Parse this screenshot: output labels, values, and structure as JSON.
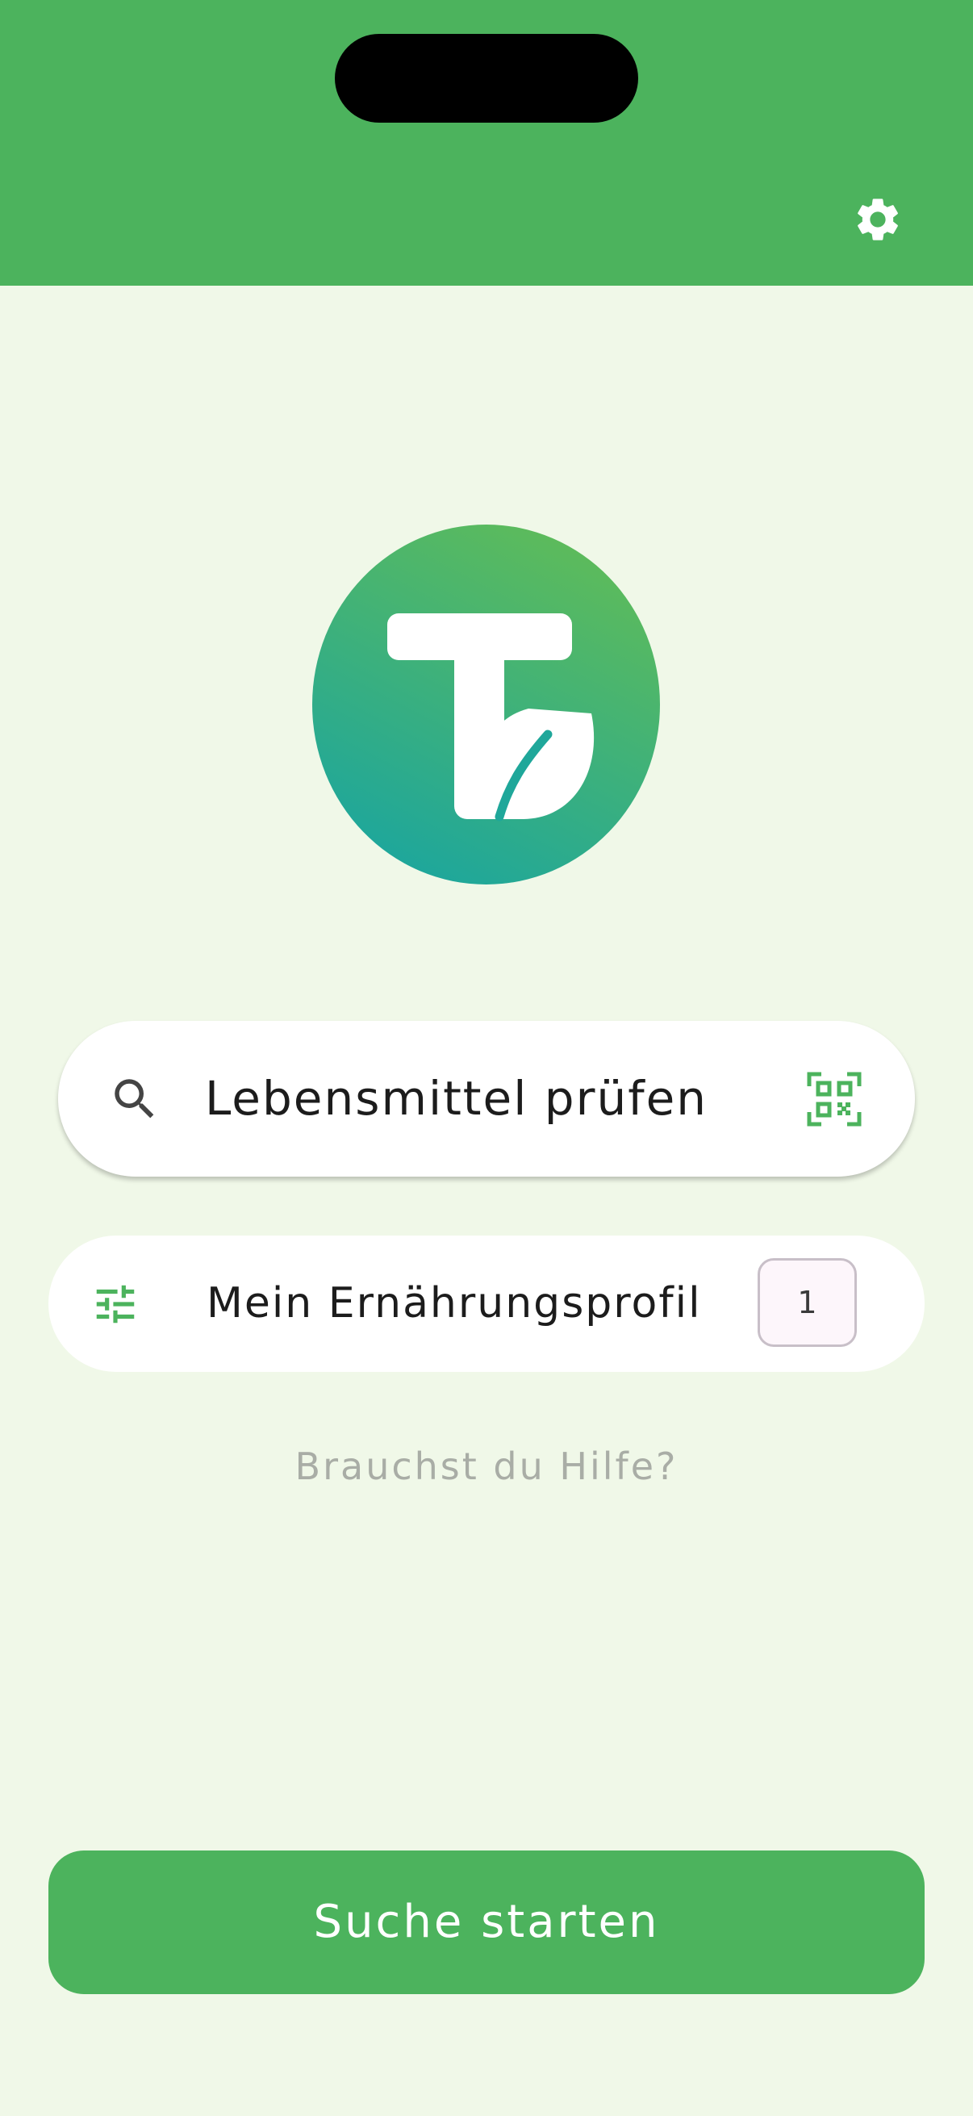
{
  "colors": {
    "brand_green": "#4CB35D",
    "background": "#F0F8E8",
    "logo_gradient_top": "#5DBB5B",
    "logo_gradient_bottom": "#1FA79A"
  },
  "header": {
    "settings_icon": "gear-icon"
  },
  "logo": {
    "icon": "leaf-t-logo"
  },
  "search": {
    "label": "Lebensmittel prüfen",
    "search_icon": "search-icon",
    "scan_icon": "qr-code-scan-icon"
  },
  "profile": {
    "label": "Mein Ernährungsprofil",
    "icon": "tune-sliders-icon",
    "badge_count": "1"
  },
  "help": {
    "label": "Brauchst du Hilfe?"
  },
  "actions": {
    "start_label": "Suche starten"
  }
}
